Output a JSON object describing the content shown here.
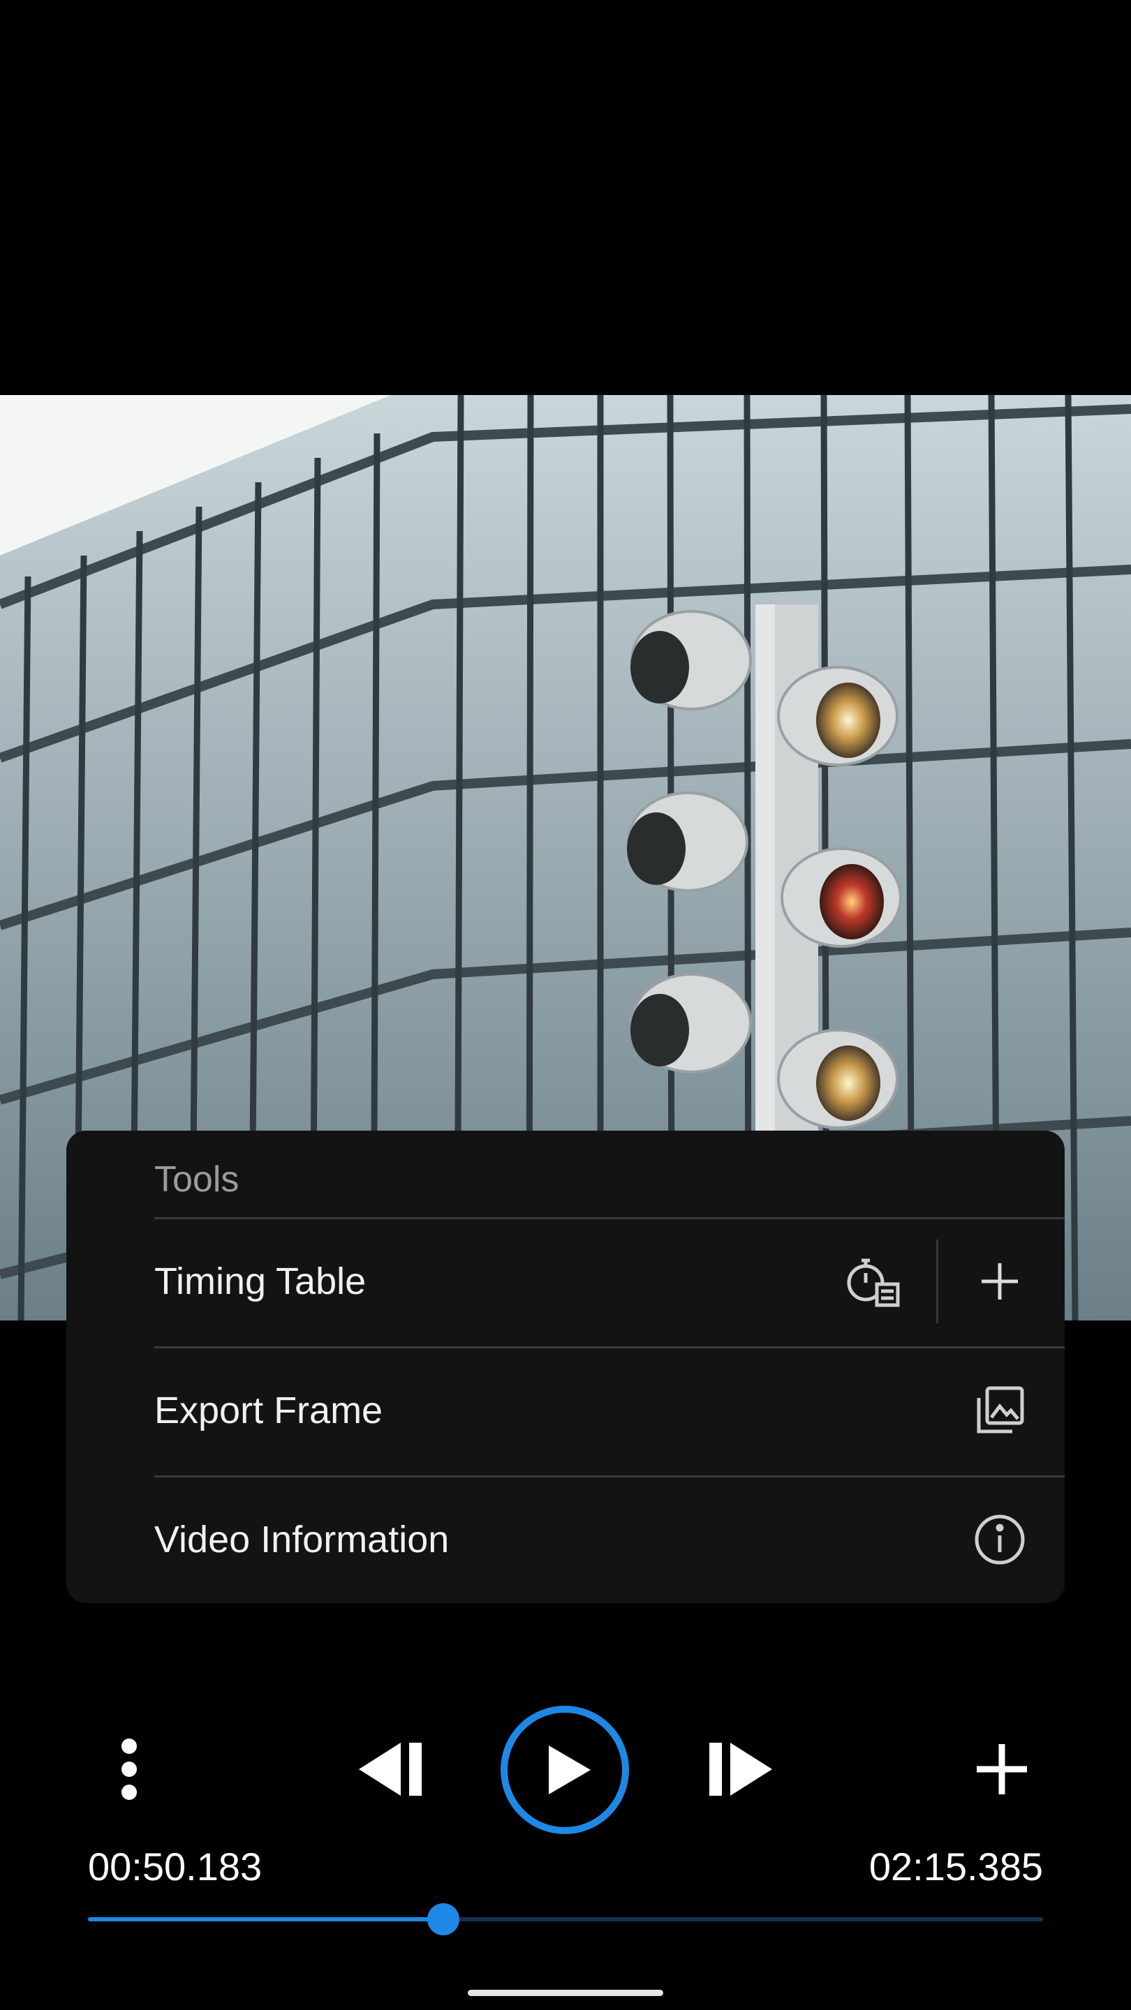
{
  "menu": {
    "title": "Tools",
    "items": [
      {
        "label": "Timing Table",
        "icons": [
          "stopwatch-list-icon",
          "plus-icon"
        ]
      },
      {
        "label": "Export Frame",
        "icons": [
          "gallery-icon"
        ]
      },
      {
        "label": "Video Information",
        "icons": [
          "info-icon"
        ]
      }
    ]
  },
  "player": {
    "current_time": "00:50.183",
    "total_time": "02:15.385",
    "progress": 0.372,
    "accent_color": "#1e88e5"
  },
  "controls": [
    "more-vert-icon",
    "step-back-icon",
    "play-icon",
    "step-forward-icon",
    "add-icon"
  ]
}
